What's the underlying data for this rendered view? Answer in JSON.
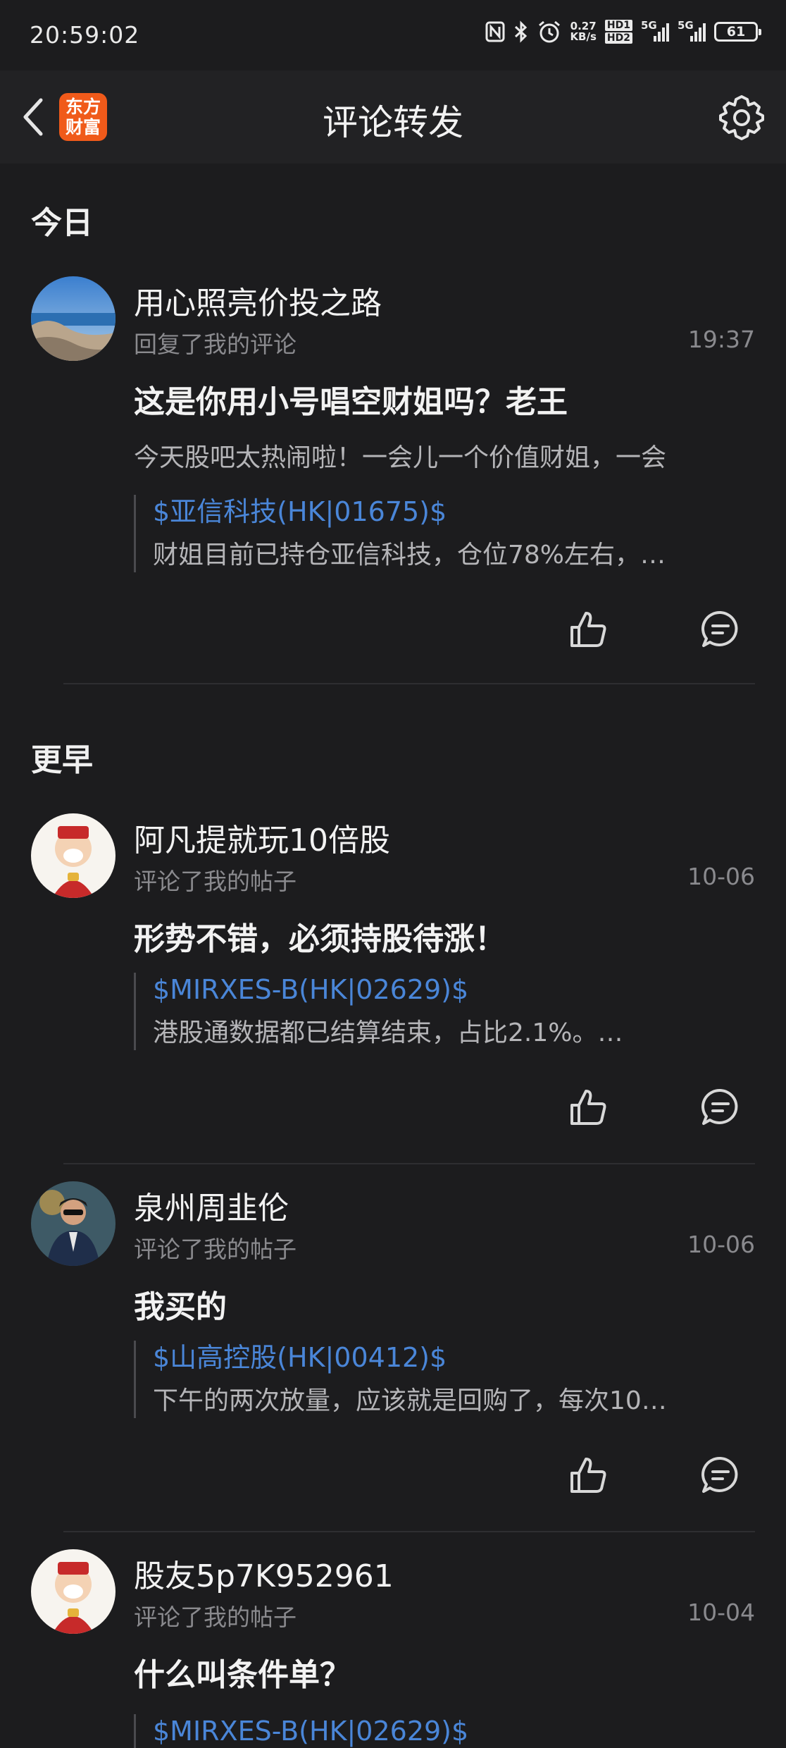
{
  "status": {
    "time": "20:59:02",
    "net_speed_value": "0.27",
    "net_speed_unit": "KB/s",
    "hd1": "HD1",
    "hd2": "HD2",
    "signal1": "5G",
    "signal2": "5G",
    "battery": "61"
  },
  "nav": {
    "title": "评论转发",
    "logo_line1": "东方",
    "logo_line2": "财富"
  },
  "sections": {
    "today": "今日",
    "earlier": "更早"
  },
  "posts": [
    {
      "username": "用心照亮价投之路",
      "action": "回复了我的评论",
      "time": "19:37",
      "comment": "这是你用小号唱空财姐吗？老王",
      "sub_comment": "今天股吧太热闹啦！一会儿一个价值财姐，一会",
      "quote_link": "$亚信科技(HK|01675)$",
      "quote_text": "财姐目前已持仓亚信科技，仓位78%左右，…"
    },
    {
      "username": "阿凡提就玩10倍股",
      "action": "评论了我的帖子",
      "time": "10-06",
      "comment": "形势不错，必须持股待涨！",
      "quote_link": "$MIRXES-B(HK|02629)$",
      "quote_text": "港股通数据都已结算结束，占比2.1%。…"
    },
    {
      "username": "泉州周韭伦",
      "action": "评论了我的帖子",
      "time": "10-06",
      "comment": "我买的",
      "quote_link": "$山高控股(HK|00412)$",
      "quote_text": "下午的两次放量，应该就是回购了，每次10…"
    },
    {
      "username": "股友5p7K952961",
      "action": "评论了我的帖子",
      "time": "10-04",
      "comment": "什么叫条件单？",
      "quote_link": "$MIRXES-B(HK|02629)$"
    }
  ],
  "colors": {
    "background": "#1c1c1e",
    "link": "#4a86d8",
    "logo": "#f05a1a"
  }
}
